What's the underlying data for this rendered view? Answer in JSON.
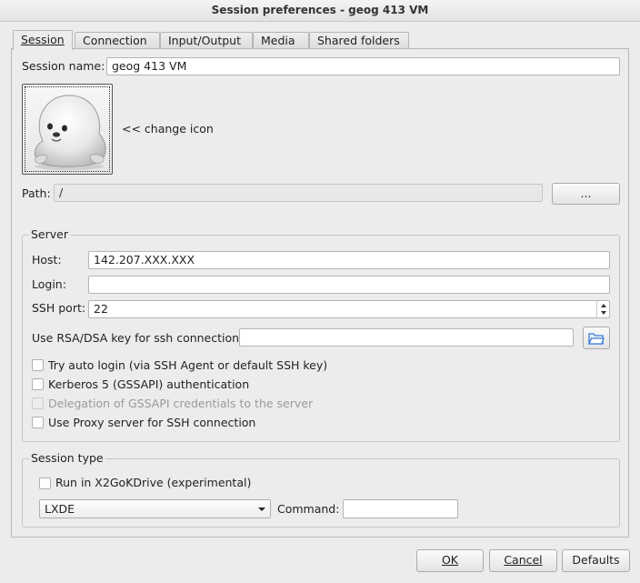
{
  "window": {
    "title": "Session preferences - geog 413 VM"
  },
  "tabs": [
    {
      "label": "Session",
      "active": true
    },
    {
      "label": "Connection",
      "active": false
    },
    {
      "label": "Input/Output",
      "active": false
    },
    {
      "label": "Media",
      "active": false
    },
    {
      "label": "Shared folders",
      "active": false
    }
  ],
  "session": {
    "name_label": "Session name:",
    "name_value": "geog 413 VM",
    "change_icon_label": "<< change icon",
    "path_label": "Path:",
    "path_value": "/",
    "browse_label": "..."
  },
  "server": {
    "group_label": "Server",
    "host_label": "Host:",
    "host_value": "142.207.XXX.XXX",
    "login_label": "Login:",
    "login_value": "",
    "ssh_port_label": "SSH port:",
    "ssh_port_value": "22",
    "rsa_label": "Use RSA/DSA key for ssh connection:",
    "rsa_value": "",
    "options": [
      {
        "label": "Try auto login (via SSH Agent or default SSH key)",
        "checked": false,
        "enabled": true
      },
      {
        "label": "Kerberos 5 (GSSAPI) authentication",
        "checked": false,
        "enabled": true
      },
      {
        "label": "Delegation of GSSAPI credentials to the server",
        "checked": false,
        "enabled": false
      },
      {
        "label": "Use Proxy server for SSH connection",
        "checked": false,
        "enabled": true
      }
    ]
  },
  "session_type": {
    "group_label": "Session type",
    "kdrive_label": "Run in X2GoKDrive (experimental)",
    "type_value": "LXDE",
    "command_label": "Command:",
    "command_value": ""
  },
  "buttons": {
    "ok": "OK",
    "cancel": "Cancel",
    "defaults": "Defaults"
  },
  "colors": {
    "window_bg": "#ececec",
    "folder_icon": "#3a7bd5"
  }
}
